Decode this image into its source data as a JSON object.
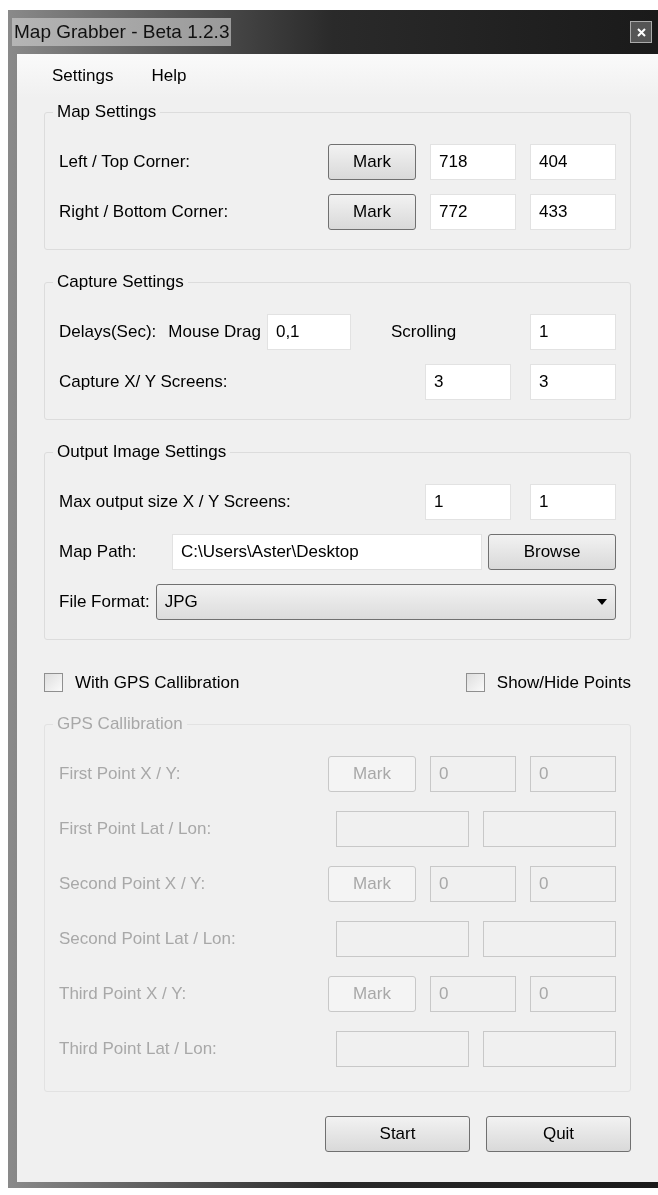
{
  "window": {
    "title": "Map Grabber - Beta 1.2.3"
  },
  "menu": [
    "Settings",
    "Help"
  ],
  "groups": [
    {
      "title": "Map Settings",
      "disabled": false,
      "rows": [
        {
          "kind": "mark",
          "label": "Left / Top Corner:",
          "button": "Mark",
          "values": [
            "718",
            "404"
          ]
        },
        {
          "kind": "mark",
          "label": "Right / Bottom Corner:",
          "button": "Mark",
          "values": [
            "772",
            "433"
          ]
        }
      ]
    },
    {
      "title": "Capture Settings",
      "disabled": false,
      "rows": [
        {
          "kind": "delays",
          "label": "Delays(Sec):",
          "drag_label": "Mouse Drag",
          "drag_value": "0,1",
          "scroll_label": "Scrolling",
          "scroll_value": "1"
        },
        {
          "kind": "pair",
          "label": "Capture X/ Y Screens:",
          "values": [
            "3",
            "3"
          ]
        }
      ]
    },
    {
      "title": "Output Image Settings",
      "disabled": false,
      "rows": [
        {
          "kind": "pair",
          "label": "Max output size X / Y Screens:",
          "values": [
            "1",
            "1"
          ]
        },
        {
          "kind": "path",
          "label": "Map Path:",
          "value": "C:\\Users\\Aster\\Desktop",
          "button": "Browse"
        },
        {
          "kind": "select",
          "label": "File Format:",
          "value": "JPG"
        }
      ]
    }
  ],
  "checkboxes": [
    {
      "label": "With GPS Callibration",
      "checked": false
    },
    {
      "label": "Show/Hide Points",
      "checked": false
    }
  ],
  "gps": {
    "title": "GPS Callibration",
    "disabled": true,
    "rows": [
      {
        "kind": "mark",
        "label": "First Point X / Y:",
        "button": "Mark",
        "values": [
          "0",
          "0"
        ]
      },
      {
        "kind": "latlon",
        "label": "First Point Lat / Lon:"
      },
      {
        "kind": "mark",
        "label": "Second Point X / Y:",
        "button": "Mark",
        "values": [
          "0",
          "0"
        ]
      },
      {
        "kind": "latlon",
        "label": "Second Point  Lat / Lon:"
      },
      {
        "kind": "mark",
        "label": "Third Point X / Y:",
        "button": "Mark",
        "values": [
          "0",
          "0"
        ]
      },
      {
        "kind": "latlon",
        "label": "Third Point  Lat / Lon:"
      }
    ]
  },
  "buttons": [
    "Start",
    "Quit"
  ]
}
